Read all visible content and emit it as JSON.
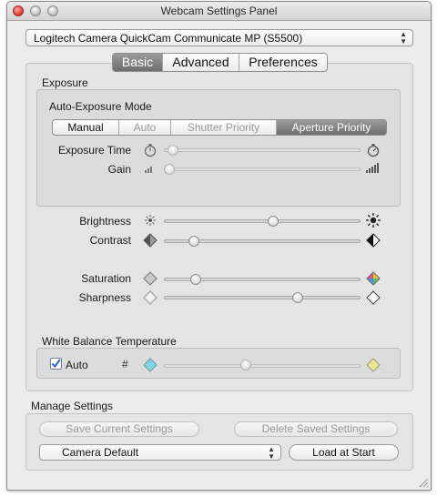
{
  "window": {
    "title": "Webcam Settings Panel"
  },
  "camera_select": {
    "value": "Logitech Camera QuickCam Communicate MP (S5500)"
  },
  "tabs": [
    {
      "label": "Basic",
      "selected": true
    },
    {
      "label": "Advanced",
      "selected": false
    },
    {
      "label": "Preferences",
      "selected": false
    }
  ],
  "exposure": {
    "section_label": "Exposure",
    "mode_label": "Auto-Exposure Mode",
    "modes": [
      {
        "label": "Manual",
        "state": "normal"
      },
      {
        "label": "Auto",
        "state": "disabled"
      },
      {
        "label": "Shutter Priority",
        "state": "disabled"
      },
      {
        "label": "Aperture Priority",
        "state": "selected"
      }
    ],
    "exposure_time_label": "Exposure Time",
    "exposure_time_value": 0.02,
    "gain_label": "Gain",
    "gain_value": 0.0
  },
  "sliders": {
    "brightness": {
      "label": "Brightness",
      "value": 0.56
    },
    "contrast": {
      "label": "Contrast",
      "value": 0.13
    },
    "saturation": {
      "label": "Saturation",
      "value": 0.14
    },
    "sharpness": {
      "label": "Sharpness",
      "value": 0.69
    }
  },
  "white_balance": {
    "section_label": "White Balance Temperature",
    "auto_label": "Auto",
    "auto_checked": true,
    "hash_label": "#",
    "value": 0.41
  },
  "manage": {
    "section_label": "Manage Settings",
    "save_label": "Save Current Settings",
    "delete_label": "Delete Saved Settings",
    "profile_value": "Camera Default",
    "load_label": "Load at Start"
  },
  "colors": {
    "selected_segment": "#7d7d7d",
    "wb_cool": "#7fd6e0",
    "wb_warm": "#e8e890",
    "checkbox_blue": "#2a62c9"
  }
}
